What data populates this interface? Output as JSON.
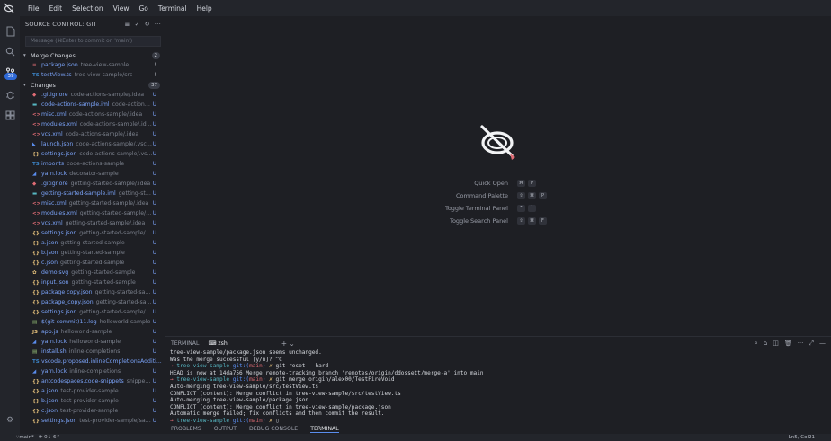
{
  "menubar": {
    "logo_icon": "app-logo-icon",
    "items": [
      "File",
      "Edit",
      "Selection",
      "View",
      "Go",
      "Terminal",
      "Help"
    ]
  },
  "activitybar": {
    "icons": [
      "files-icon",
      "search-icon",
      "source-control-icon",
      "debug-icon",
      "extensions-icon"
    ],
    "scm_badge": "39",
    "settings_icon": "gear-icon"
  },
  "sidebar": {
    "title": "SOURCE CONTROL: GIT",
    "commit_placeholder": "Message (⌘Enter to commit on 'main')",
    "merge_group": {
      "label": "Merge Changes",
      "count": "2",
      "files": [
        {
          "icon": "≡",
          "icon_color": "#e06c75",
          "name": "package.json",
          "path": "tree-view-sample",
          "status": "!"
        },
        {
          "icon": "TS",
          "icon_color": "#3b82c4",
          "name": "testView.ts",
          "path": "tree-view-sample/src",
          "status": "!"
        }
      ]
    },
    "changes_group": {
      "label": "Changes",
      "count": "37",
      "files": [
        {
          "icon": "◆",
          "icon_color": "#e06c75",
          "name": ".gitignore",
          "path": "code-actions-sample/.idea",
          "status": "U"
        },
        {
          "icon": "▬",
          "icon_color": "#56b6c2",
          "name": "code-actions-sample.iml",
          "path": "code-actions-s...",
          "status": "U"
        },
        {
          "icon": "<>",
          "icon_color": "#e06c75",
          "name": "misc.xml",
          "path": "code-actions-sample/.idea",
          "status": "U"
        },
        {
          "icon": "<>",
          "icon_color": "#e06c75",
          "name": "modules.xml",
          "path": "code-actions-sample/.idea",
          "status": "U"
        },
        {
          "icon": "<>",
          "icon_color": "#e06c75",
          "name": "vcs.xml",
          "path": "code-actions-sample/.idea",
          "status": "U"
        },
        {
          "icon": "◣",
          "icon_color": "#5a8dee",
          "name": "launch.json",
          "path": "code-actions-sample/.vscode",
          "status": "U"
        },
        {
          "icon": "{}",
          "icon_color": "#e5c07b",
          "name": "settings.json",
          "path": "code-actions-sample/.vscode",
          "status": "U"
        },
        {
          "icon": "TS",
          "icon_color": "#3b82c4",
          "name": "impor.ts",
          "path": "code-actions-sample",
          "status": "U"
        },
        {
          "icon": "◢",
          "icon_color": "#5a8dee",
          "name": "yarn.lock",
          "path": "decorator-sample",
          "status": "U"
        },
        {
          "icon": "◆",
          "icon_color": "#e06c75",
          "name": ".gitignore",
          "path": "getting-started-sample/.idea",
          "status": "U"
        },
        {
          "icon": "▬",
          "icon_color": "#56b6c2",
          "name": "getting-started-sample.iml",
          "path": "getting-start...",
          "status": "U"
        },
        {
          "icon": "<>",
          "icon_color": "#e06c75",
          "name": "misc.xml",
          "path": "getting-started-sample/.idea",
          "status": "U"
        },
        {
          "icon": "<>",
          "icon_color": "#e06c75",
          "name": "modules.xml",
          "path": "getting-started-sample/.idea",
          "status": "U"
        },
        {
          "icon": "<>",
          "icon_color": "#e06c75",
          "name": "vcs.xml",
          "path": "getting-started-sample/.idea",
          "status": "U"
        },
        {
          "icon": "{}",
          "icon_color": "#e5c07b",
          "name": "settings.json",
          "path": "getting-started-sample/.vsc...",
          "status": "U"
        },
        {
          "icon": "{}",
          "icon_color": "#e5c07b",
          "name": "a.json",
          "path": "getting-started-sample",
          "status": "U"
        },
        {
          "icon": "{}",
          "icon_color": "#e5c07b",
          "name": "b.json",
          "path": "getting-started-sample",
          "status": "U"
        },
        {
          "icon": "{}",
          "icon_color": "#e5c07b",
          "name": "c.json",
          "path": "getting-started-sample",
          "status": "U"
        },
        {
          "icon": "✿",
          "icon_color": "#e5c07b",
          "name": "demo.svg",
          "path": "getting-started-sample",
          "status": "U"
        },
        {
          "icon": "{}",
          "icon_color": "#e5c07b",
          "name": "input.json",
          "path": "getting-started-sample",
          "status": "U"
        },
        {
          "icon": "{}",
          "icon_color": "#e5c07b",
          "name": "package copy.json",
          "path": "getting-started-sampl...",
          "status": "U"
        },
        {
          "icon": "{}",
          "icon_color": "#e5c07b",
          "name": "package_copy.json",
          "path": "getting-started-sampl...",
          "status": "U"
        },
        {
          "icon": "{}",
          "icon_color": "#e5c07b",
          "name": "settings.json",
          "path": "getting-started-sample/src/...",
          "status": "U"
        },
        {
          "icon": "▤",
          "icon_color": "#98c379",
          "name": "$(git-commit)11.log",
          "path": "helloworld-sample",
          "status": "U"
        },
        {
          "icon": "JS",
          "icon_color": "#e5c07b",
          "name": "app.js",
          "path": "helloworld-sample",
          "status": "U"
        },
        {
          "icon": "◢",
          "icon_color": "#5a8dee",
          "name": "yarn.lock",
          "path": "helloworld-sample",
          "status": "U"
        },
        {
          "icon": "▤",
          "icon_color": "#98c379",
          "name": "install.sh",
          "path": "inline-completions",
          "status": "U"
        },
        {
          "icon": "TS",
          "icon_color": "#3b82c4",
          "name": "vscode.proposed.inlineCompletionsAdditi...",
          "path": "",
          "status": "U"
        },
        {
          "icon": "◢",
          "icon_color": "#5a8dee",
          "name": "yarn.lock",
          "path": "inline-completions",
          "status": "U"
        },
        {
          "icon": "{}",
          "icon_color": "#e5c07b",
          "name": "antcodespaces.code-snippets",
          "path": "snippet-s...",
          "status": "U"
        },
        {
          "icon": "{}",
          "icon_color": "#e5c07b",
          "name": "a.json",
          "path": "test-provider-sample",
          "status": "U"
        },
        {
          "icon": "{}",
          "icon_color": "#e5c07b",
          "name": "b.json",
          "path": "test-provider-sample",
          "status": "U"
        },
        {
          "icon": "{}",
          "icon_color": "#e5c07b",
          "name": "c.json",
          "path": "test-provider-sample",
          "status": "U"
        },
        {
          "icon": "{}",
          "icon_color": "#e5c07b",
          "name": "settings.json",
          "path": "test-provider-sample/sampl...",
          "status": "U"
        }
      ]
    }
  },
  "editor": {
    "watermark_icon": "app-logo-watermark-icon",
    "shortcuts": [
      {
        "label": "Quick Open",
        "keys": [
          "⌘",
          "P"
        ]
      },
      {
        "label": "Command Palette",
        "keys": [
          "⇧",
          "⌘",
          "P"
        ]
      },
      {
        "label": "Toggle Terminal Panel",
        "keys": [
          "^",
          "`"
        ]
      },
      {
        "label": "Toggle Search Panel",
        "keys": [
          "⇧",
          "⌘",
          "F"
        ]
      }
    ]
  },
  "terminal": {
    "tab_terminal": "TERMINAL",
    "tab_shell": "zsh",
    "lines": [
      {
        "type": "out",
        "text": "tree-view-sample/package.json seems unchanged."
      },
      {
        "type": "out",
        "text": "Was the merge successful [y/n]? ^C"
      },
      {
        "type": "cmd",
        "dir": "tree-view-sample",
        "git": "git:(",
        "branch": "main",
        "close": ")",
        "mark": "✗",
        "cmd": "git reset --hard"
      },
      {
        "type": "out",
        "text": "HEAD is now at 14da756 Merge remote-tracking branch 'remotes/origin/ddossett/merge-a' into main"
      },
      {
        "type": "cmd",
        "dir": "tree-view-sample",
        "git": "git:(",
        "branch": "main",
        "close": ")",
        "mark": "✗",
        "cmd": "git merge origin/alex00/TestFireVoid"
      },
      {
        "type": "out",
        "text": "Auto-merging tree-view-sample/src/testView.ts"
      },
      {
        "type": "out",
        "text": "CONFLICT (content): Merge conflict in tree-view-sample/src/testView.ts"
      },
      {
        "type": "out",
        "text": "Auto-merging tree-view-sample/package.json"
      },
      {
        "type": "out",
        "text": "CONFLICT (content): Merge conflict in tree-view-sample/package.json"
      },
      {
        "type": "out",
        "text": "Automatic merge failed; fix conflicts and then commit the result."
      },
      {
        "type": "cmd",
        "dir": "tree-view-sample",
        "git": "git:(",
        "branch": "main",
        "close": ")",
        "mark": "✗",
        "cmd": "▯"
      }
    ]
  },
  "panel_tabs": [
    "PROBLEMS",
    "OUTPUT",
    "DEBUG CONSOLE",
    "TERMINAL"
  ],
  "statusbar": {
    "branch": "main*",
    "sync": "⟳ 0↓ 6↑",
    "position": "Ln5, Col21"
  }
}
